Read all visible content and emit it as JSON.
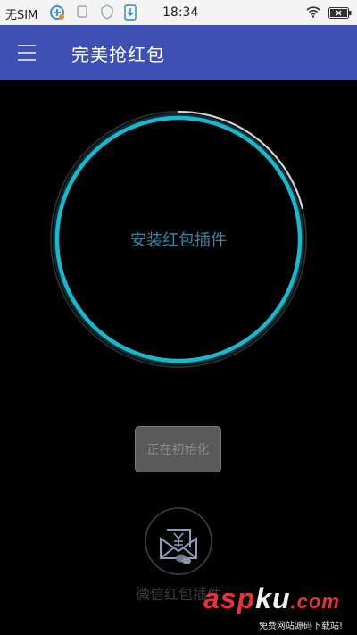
{
  "status_bar": {
    "carrier": "无SIM",
    "time": "18:34",
    "battery_icon": "battery-icon",
    "wifi_icon": "wifi-icon"
  },
  "app_bar": {
    "title": "完美抢红包",
    "background": "#3e50b4"
  },
  "main": {
    "install_label": "安装红包插件",
    "ring_color": "#19b8cc",
    "init_button_label": "正在初始化"
  },
  "plugin": {
    "icon": "wechat-envelope-icon",
    "label": "微信红包插件"
  },
  "watermark": {
    "logo_part1": "asp",
    "logo_part2": "ku",
    "logo_part3": ".com",
    "tagline": "免费网站源码下载站!"
  }
}
